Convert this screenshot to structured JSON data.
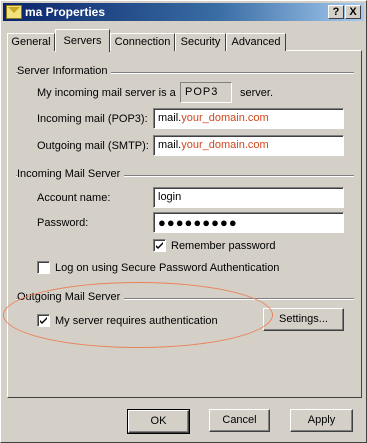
{
  "window": {
    "title": "ma Properties",
    "help_button": "?",
    "close_button": "X"
  },
  "tabs": [
    {
      "label": "General",
      "active": false
    },
    {
      "label": "Servers",
      "active": true
    },
    {
      "label": "Connection",
      "active": false
    },
    {
      "label": "Security",
      "active": false
    },
    {
      "label": "Advanced",
      "active": false
    }
  ],
  "server_info": {
    "group_label": "Server Information",
    "incoming_prefix": "My incoming mail server is a",
    "server_type": "POP3",
    "incoming_suffix": "server.",
    "incoming_label": "Incoming mail (POP3):",
    "incoming_value_prefix": "mail.",
    "incoming_value_domain": "your_domain.com",
    "outgoing_label": "Outgoing mail (SMTP):",
    "outgoing_value_prefix": "mail.",
    "outgoing_value_domain": "your_domain.com"
  },
  "incoming_server": {
    "group_label": "Incoming Mail Server",
    "account_label": "Account name:",
    "account_value": "login",
    "password_label": "Password:",
    "password_value": "●●●●●●●●●",
    "remember_label": "Remember password",
    "remember_checked": true,
    "spa_label": "Log on using Secure Password Authentication",
    "spa_checked": false
  },
  "outgoing_server": {
    "group_label": "Outgoing Mail Server",
    "auth_label": "My server requires authentication",
    "auth_checked": true,
    "settings_button": "Settings..."
  },
  "footer": {
    "ok": "OK",
    "cancel": "Cancel",
    "apply": "Apply"
  },
  "colors": {
    "domain_text": "#d2461e",
    "highlight_ellipse": "#e8835a",
    "title_gradient_start": "#0a246a"
  }
}
